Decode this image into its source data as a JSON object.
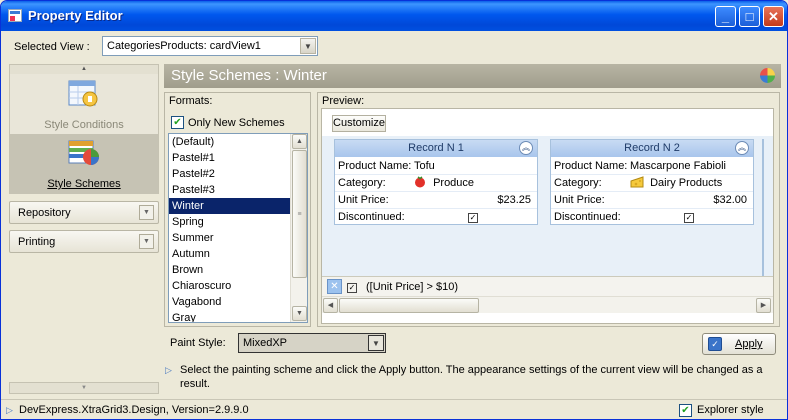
{
  "window": {
    "title": "Property Editor"
  },
  "title_buttons": {
    "minimize": "_",
    "maximize": "□",
    "close": "✕"
  },
  "top": {
    "selected_view_label": "Selected View :",
    "selected_view_value": "CategoriesProducts: cardView1"
  },
  "left_nav": {
    "items": [
      {
        "label": "Style Conditions",
        "icon": "style-conditions-icon"
      },
      {
        "label": "Style Schemes",
        "icon": "style-schemes-icon",
        "active": true
      }
    ],
    "groups": [
      {
        "label": "Repository"
      },
      {
        "label": "Printing"
      }
    ]
  },
  "header": {
    "title": "Style Schemes : Winter"
  },
  "formats": {
    "caption": "Formats:",
    "only_new_label": "Only New Schemes",
    "only_new_checked": true,
    "items": [
      "(Default)",
      "Pastel#1",
      "Pastel#2",
      "Pastel#3",
      "Winter",
      "Spring",
      "Summer",
      "Autumn",
      "Brown",
      "Chiaroscuro",
      "Vagabond",
      "Gray"
    ],
    "selected": "Winter"
  },
  "preview": {
    "caption": "Preview:",
    "customize_label": "Customize",
    "field_labels": {
      "name": "Product Name:",
      "category": "Category:",
      "price": "Unit Price:",
      "discontinued": "Discontinued:"
    },
    "cards": [
      {
        "header": "Record N 1",
        "product": "Tofu",
        "category": "Produce",
        "price": "$23.25",
        "discontinued": true
      },
      {
        "header": "Record N 2",
        "product": "Mascarpone Fabioli",
        "category": "Dairy Products",
        "price": "$32.00",
        "discontinued": true
      }
    ],
    "filter_text": "([Unit Price] > $10)"
  },
  "paint_style": {
    "label": "Paint Style:",
    "value": "MixedXP"
  },
  "apply_label": "Apply",
  "hint": "Select the painting scheme and click the Apply button. The appearance settings of the current view will be changed as a result.",
  "status": {
    "version": "DevExpress.XtraGrid3.Design, Version=2.9.9.0",
    "explorer_style_label": "Explorer style",
    "explorer_style_checked": true
  },
  "colors": {
    "title_bar": "#0058EE",
    "selection": "#0A246A",
    "card_header": "#B8D0F0",
    "header_band": "#A9A693"
  }
}
